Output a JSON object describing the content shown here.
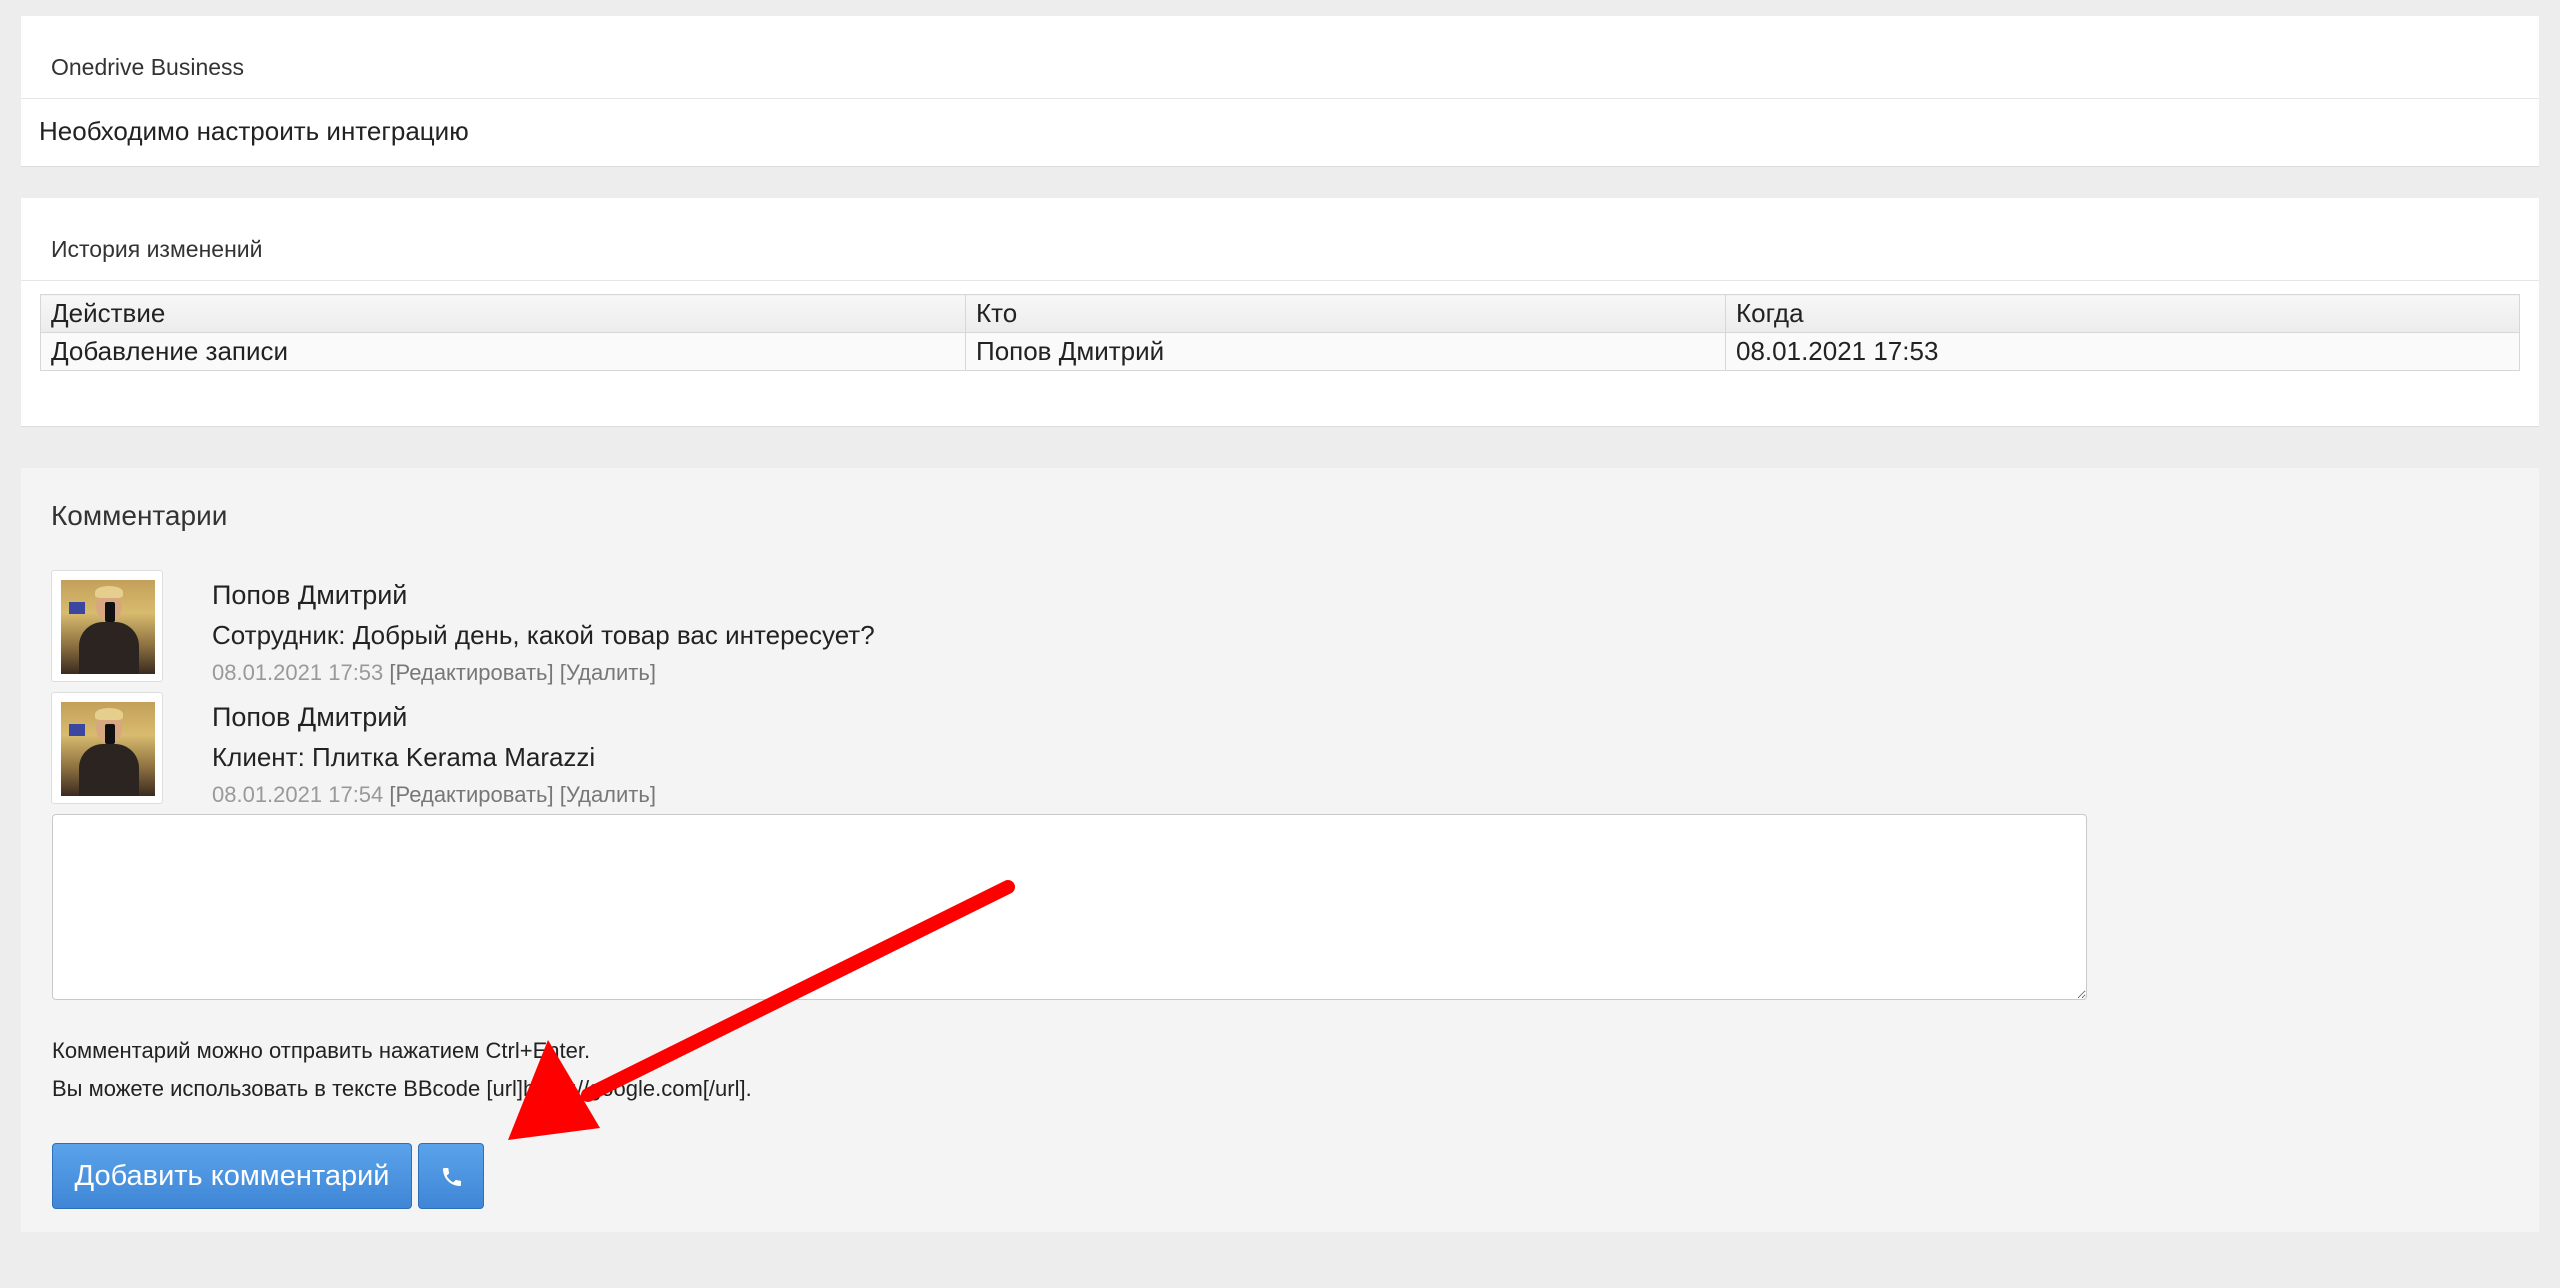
{
  "onedrive": {
    "title": "Onedrive Business",
    "notice": "Необходимо настроить интеграцию"
  },
  "history": {
    "title": "История изменений",
    "columns": [
      "Действие",
      "Кто",
      "Когда"
    ],
    "rows": [
      [
        "Добавление записи",
        "Попов Дмитрий",
        "08.01.2021 17:53"
      ]
    ]
  },
  "comments": {
    "title": "Комментарии",
    "items": [
      {
        "author": "Попов Дмитрий",
        "text": "Сотрудник: Добрый день, какой товар вас интересует?",
        "time": "08.01.2021 17:53",
        "edit": "[Редактировать]",
        "delete": "[Удалить]"
      },
      {
        "author": "Попов Дмитрий",
        "text": "Клиент: Плитка Kerama Marazzi",
        "time": "08.01.2021 17:54",
        "edit": "[Редактировать]",
        "delete": "[Удалить]"
      }
    ],
    "reply_value": "",
    "hint1": "Комментарий можно отправить нажатием Ctrl+Enter.",
    "hint2": "Вы можете использовать в тексте BBcode [url]https://google.com[/url].",
    "add_button": "Добавить комментарий",
    "call_icon": "phone-icon"
  },
  "annotation": {
    "arrow_color": "#ff0000"
  },
  "colors": {
    "accent": "#4a94e0",
    "page_bg": "#ededed"
  }
}
